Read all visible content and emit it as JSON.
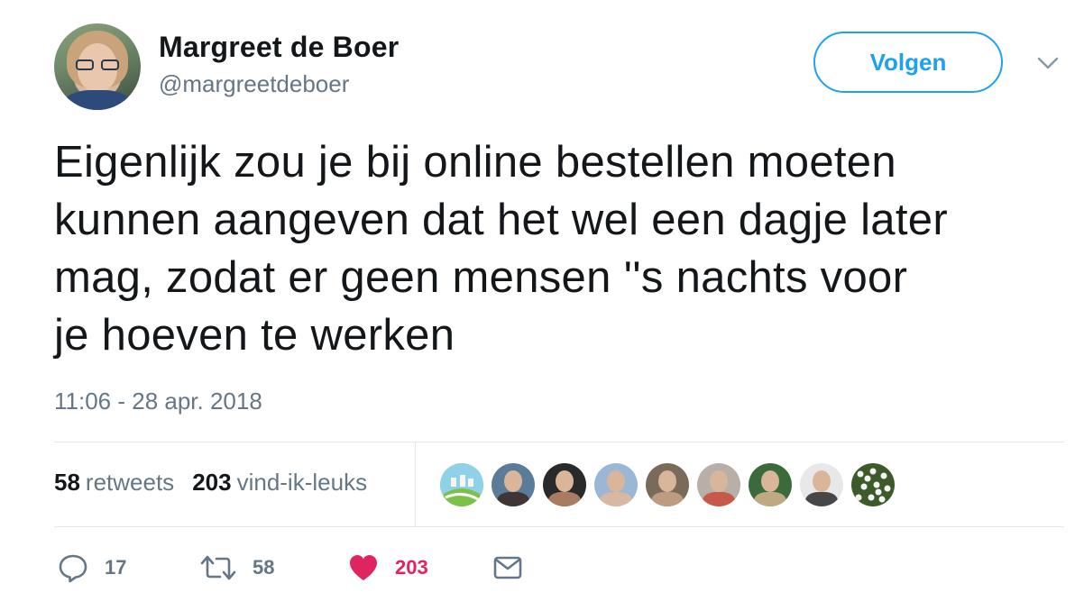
{
  "author": {
    "name": "Margreet de Boer",
    "handle": "@margreetdeboer"
  },
  "follow_button": {
    "label": "Volgen"
  },
  "tweet": {
    "lines": [
      "Eigenlijk zou je bij online bestellen moeten",
      "kunnen aangeven dat het wel een dagje later",
      "mag, zodat er geen mensen ''s nachts voor",
      "je hoeven te werken"
    ],
    "timestamp": "11:06 - 28 apr. 2018"
  },
  "stats": {
    "retweets_count": "58",
    "retweets_label": "retweets",
    "likes_count": "203",
    "likes_label": "vind-ik-leuks"
  },
  "liker_avatars": [
    {
      "icon": "logo-avatar-icon",
      "colors": [
        "#8fd1e6",
        "#ffffff"
      ]
    },
    {
      "icon": "person-avatar-icon",
      "colors": [
        "#5b7c99",
        "#3a2a22"
      ]
    },
    {
      "icon": "person-avatar-icon",
      "colors": [
        "#2a2a2a",
        "#c08a6a"
      ]
    },
    {
      "icon": "person-avatar-icon",
      "colors": [
        "#9bb7d6",
        "#e2b89a"
      ]
    },
    {
      "icon": "person-avatar-icon",
      "colors": [
        "#7a6a5a",
        "#c9a488"
      ]
    },
    {
      "icon": "person-avatar-icon",
      "colors": [
        "#b8b0a8",
        "#c94a3a"
      ]
    },
    {
      "icon": "person-avatar-icon",
      "colors": [
        "#3b6b3a",
        "#d6b48f"
      ]
    },
    {
      "icon": "person-avatar-icon",
      "colors": [
        "#e8e8e8",
        "#2a2a2a"
      ]
    },
    {
      "icon": "flowers-avatar-icon",
      "colors": [
        "#3d5a2a",
        "#f4f4f4"
      ]
    }
  ],
  "actions": {
    "reply_count": "17",
    "retweet_count": "58",
    "like_count": "203"
  },
  "colors": {
    "accent": "#1da1f2",
    "like": "#e0245e",
    "muted": "#657786",
    "divider": "#e1e8ed"
  }
}
